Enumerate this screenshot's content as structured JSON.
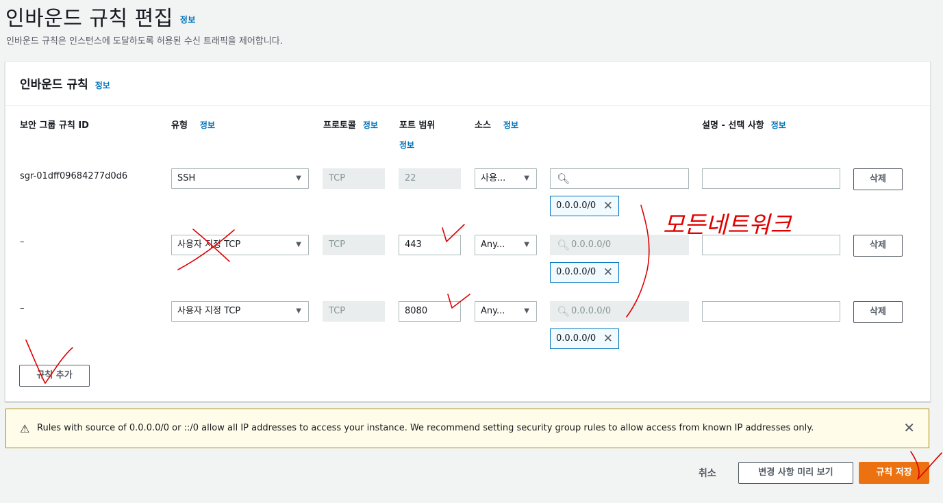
{
  "header": {
    "title": "인바운드 규칙 편집",
    "info": "정보",
    "description": "인바운드 규칙은 인스턴스에 도달하도록 허용된 수신 트래픽을 제어합니다."
  },
  "panel": {
    "title": "인바운드 규칙",
    "info": "정보"
  },
  "columns": {
    "rule_id": "보안 그룹 규칙 ID",
    "type": "유형",
    "protocol": "프로토콜",
    "port_range": "포트 범위",
    "source": "소스",
    "description": "설명 - 선택 사항",
    "info": "정보"
  },
  "rules": [
    {
      "id": "sgr-01dff09684277d0d6",
      "type": "SSH",
      "protocol": "TCP",
      "port": "22",
      "source_type": "사용...",
      "search_value": "",
      "token": "0.0.0.0/0",
      "description": "",
      "delete": "삭제"
    },
    {
      "id": "–",
      "type": "사용자 지정 TCP",
      "protocol": "TCP",
      "port": "443",
      "source_type": "Any...",
      "search_value": "0.0.0.0/0",
      "token": "0.0.0.0/0",
      "description": "",
      "delete": "삭제"
    },
    {
      "id": "–",
      "type": "사용자 지정 TCP",
      "protocol": "TCP",
      "port": "8080",
      "source_type": "Any...",
      "search_value": "0.0.0.0/0",
      "token": "0.0.0.0/0",
      "description": "",
      "delete": "삭제"
    }
  ],
  "add_rule": "규칙 추가",
  "warning": {
    "text": "Rules with source of 0.0.0.0/0 or ::/0 allow all IP addresses to access your instance. We recommend setting security group rules to allow access from known IP addresses only."
  },
  "footer": {
    "cancel": "취소",
    "preview": "변경 사항 미리 보기",
    "save": "규칙 저장"
  },
  "handwriting": {
    "note": "모든네트워크"
  },
  "colors": {
    "primary": "#ec7211",
    "link": "#0073bb",
    "annotation": "#e00000"
  }
}
